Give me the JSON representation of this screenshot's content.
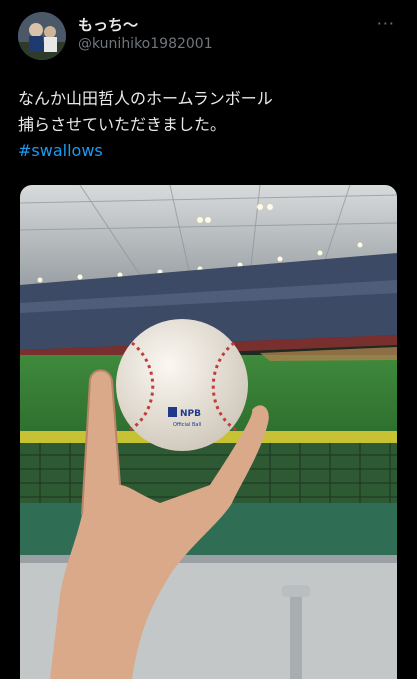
{
  "author": {
    "display_name": "もっち〜",
    "handle": "@kunihiko1982001",
    "avatar_icon": "user-avatar"
  },
  "more_icon": "more-icon",
  "more_label": "···",
  "tweet": {
    "lines": [
      "なんか山田哲人のホームランボール",
      "捕らさせていただきました。"
    ],
    "hashtag": "#swallows"
  },
  "media": {
    "ball_logo": "NPB",
    "ball_sub": "Official Ball"
  },
  "colors": {
    "background": "#000000",
    "text": "#e7e9ea",
    "muted": "#71767b",
    "link": "#1d9bf0"
  }
}
